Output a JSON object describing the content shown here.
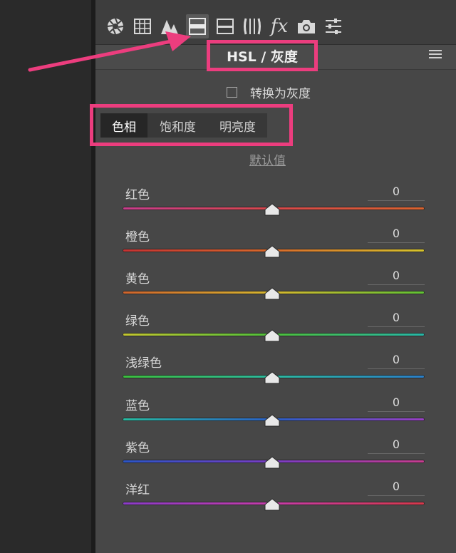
{
  "toolbar": {
    "icons": [
      "aperture-icon",
      "grid-icon",
      "mountains-icon",
      "hsl-icon",
      "split-toning-icon",
      "lens-icon",
      "fx-icon",
      "camera-icon",
      "sliders-icon"
    ],
    "fx_label": "fx"
  },
  "panel": {
    "title": "HSL / 灰度",
    "convert_label": "转换为灰度",
    "convert_checked": false,
    "tabs": [
      {
        "label": "色相",
        "active": true
      },
      {
        "label": "饱和度",
        "active": false
      },
      {
        "label": "明亮度",
        "active": false
      }
    ],
    "default_link": "默认值",
    "sliders": [
      {
        "label": "红色",
        "value": "0",
        "position": 0.5,
        "colors": [
          "#c83c8c",
          "#d8474a",
          "#d9632e"
        ]
      },
      {
        "label": "橙色",
        "value": "0",
        "position": 0.5,
        "colors": [
          "#c63232",
          "#d86a2a",
          "#d6c42b"
        ]
      },
      {
        "label": "黄色",
        "value": "0",
        "position": 0.5,
        "colors": [
          "#d0632c",
          "#d6b82e",
          "#5fc233"
        ]
      },
      {
        "label": "绿色",
        "value": "0",
        "position": 0.5,
        "colors": [
          "#c4c62e",
          "#4cc03a",
          "#26b7a8"
        ]
      },
      {
        "label": "浅绿色",
        "value": "0",
        "position": 0.5,
        "colors": [
          "#3bbf3c",
          "#2bb9a0",
          "#2a7ec8"
        ]
      },
      {
        "label": "蓝色",
        "value": "0",
        "position": 0.5,
        "colors": [
          "#27bba0",
          "#2a5fc6",
          "#9a3fc4"
        ]
      },
      {
        "label": "紫色",
        "value": "0",
        "position": 0.5,
        "colors": [
          "#2a55c6",
          "#7a3cc4",
          "#c63c8e"
        ]
      },
      {
        "label": "洋红",
        "value": "0",
        "position": 0.5,
        "colors": [
          "#8a3bc8",
          "#c63ca8",
          "#d6384a"
        ]
      }
    ]
  },
  "accent": "#ec3d7e"
}
